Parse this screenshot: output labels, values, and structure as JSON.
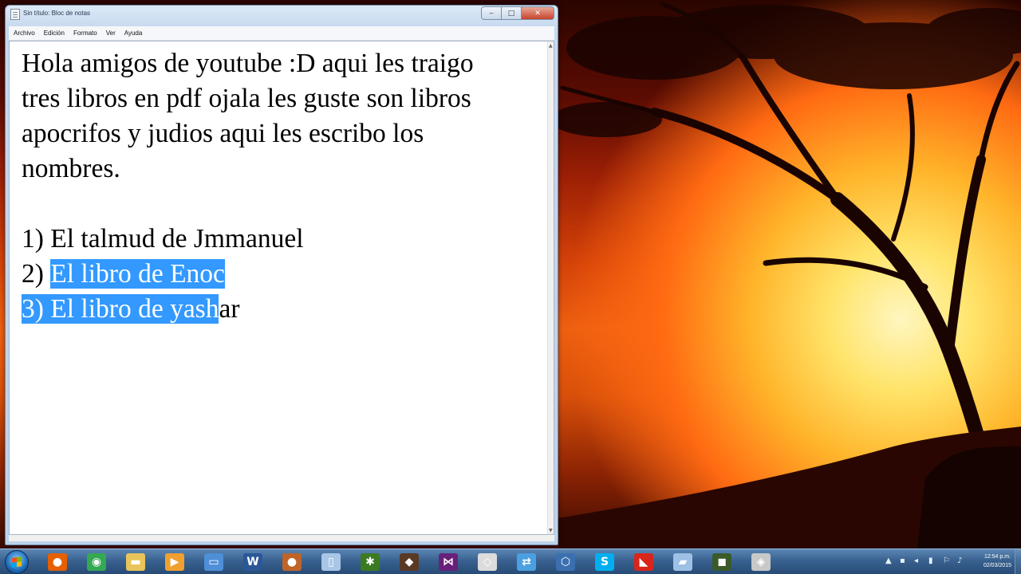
{
  "window": {
    "title": "Sin título: Bloc de notas",
    "minimize": "‒",
    "maximize": "□",
    "close": "✕"
  },
  "menu": [
    "Archivo",
    "Edición",
    "Formato",
    "Ver",
    "Ayuda"
  ],
  "editor": {
    "lines": [
      "Hola amigos de youtube :D aqui les traigo",
      "tres libros en pdf ojala les guste son libros",
      "apocrifos y judios aqui les escribo los",
      "nombres.",
      "",
      "1) El talmud de Jmmanuel",
      "2) ",
      "El libro de Enoc",
      "3) El libro de yash",
      "ar"
    ]
  },
  "taskbar": {
    "apps": [
      {
        "name": "firefox",
        "glyph": "●",
        "color": "#e66000"
      },
      {
        "name": "chrome",
        "glyph": "◉",
        "color": "#34a853"
      },
      {
        "name": "explorer",
        "glyph": "▬",
        "color": "#e8c45a"
      },
      {
        "name": "media-player",
        "glyph": "▶",
        "color": "#f0a030"
      },
      {
        "name": "remote-desktop",
        "glyph": "▭",
        "color": "#4f8fd8"
      },
      {
        "name": "word",
        "glyph": "W",
        "color": "#2b5797"
      },
      {
        "name": "game",
        "glyph": "●",
        "color": "#c0642a"
      },
      {
        "name": "notepad",
        "glyph": "▯",
        "color": "#a9c6e6"
      },
      {
        "name": "game-green",
        "glyph": "✱",
        "color": "#3c7a22"
      },
      {
        "name": "game-dark",
        "glyph": "◆",
        "color": "#5a3a24"
      },
      {
        "name": "visual-studio",
        "glyph": "⋈",
        "color": "#68217a"
      },
      {
        "name": "unity",
        "glyph": "◇",
        "color": "#dcdcdc"
      },
      {
        "name": "network",
        "glyph": "⇄",
        "color": "#4aa0e0"
      },
      {
        "name": "virtualbox",
        "glyph": "⬡",
        "color": "#3b6fb0"
      },
      {
        "name": "skype",
        "glyph": "S",
        "color": "#00aff0"
      },
      {
        "name": "acrobat",
        "glyph": "◣",
        "color": "#d8261c"
      },
      {
        "name": "window-app",
        "glyph": "▰",
        "color": "#9dc0e4"
      },
      {
        "name": "game-app",
        "glyph": "◼",
        "color": "#3a5a2a"
      },
      {
        "name": "tool-app",
        "glyph": "◈",
        "color": "#c8c8c8"
      }
    ],
    "tray": [
      "▲",
      "▪",
      "◂",
      "▮",
      "⚐",
      "♪"
    ],
    "time": "12:54 p.m.",
    "date": "02/03/2015"
  }
}
